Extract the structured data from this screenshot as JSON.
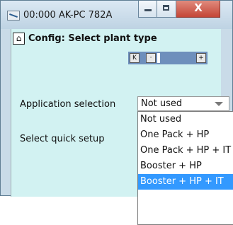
{
  "window": {
    "title": "00:000 AK-PC 782A",
    "controls": {
      "close_glyph": "X"
    }
  },
  "header": {
    "home_icon": "home-icon",
    "title": "Config: Select plant type"
  },
  "navigation": {
    "buttons": [
      {
        "name": "first",
        "glyph": "K"
      },
      {
        "name": "prev",
        "glyph": "·"
      },
      {
        "name": "next",
        "glyph": "+"
      }
    ]
  },
  "form": {
    "application_selection": {
      "label": "Application selection",
      "value": "Not used",
      "options": [
        "Not used",
        "One Pack + HP",
        "One Pack + HP + IT",
        "Booster + HP",
        "Booster + HP + IT"
      ],
      "highlighted": "Booster + HP + IT"
    },
    "quick_setup": {
      "label": "Select quick setup"
    }
  },
  "colors": {
    "accent": "#3399ff",
    "content_bg": "#d2f2f2",
    "nav_bar": "#6e8fbc"
  }
}
